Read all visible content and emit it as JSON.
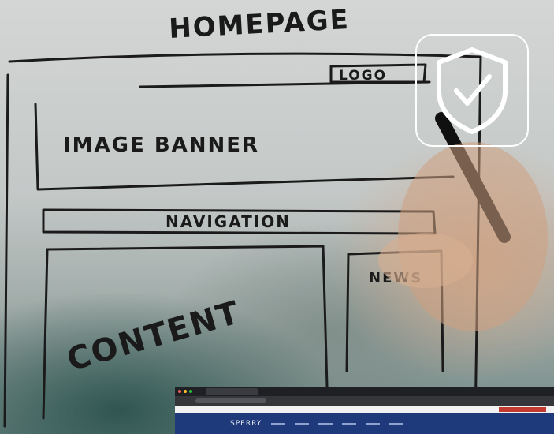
{
  "sketch": {
    "title": "HOMEPAGE",
    "logo": "LOGO",
    "banner": "IMAGE BANNER",
    "navigation": "NAVIGATION",
    "news": "NEWS",
    "content": "CONTENT"
  },
  "overlay": {
    "icon": "shield-check-icon",
    "color": "#ffffff"
  },
  "browser_preview": {
    "brand": "SPERRY"
  }
}
